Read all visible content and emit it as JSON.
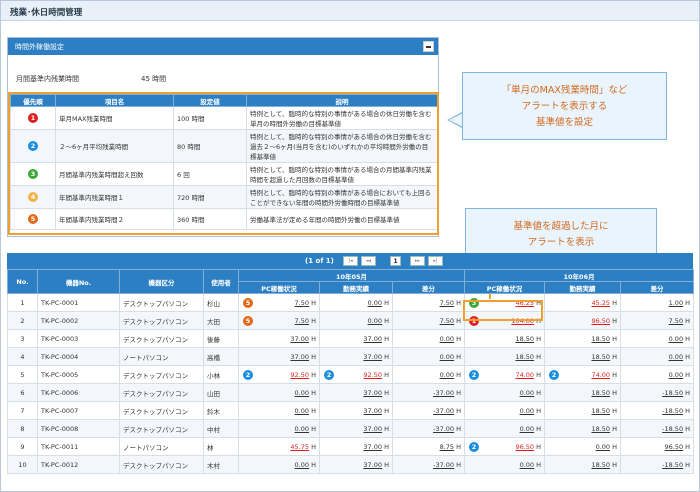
{
  "page": {
    "title": "残業･休日時間管理"
  },
  "panel": {
    "title": "時間外稼働設定",
    "limit_label": "月間基準内残業時間",
    "limit_value": "45 時間"
  },
  "settings": {
    "headers": [
      "優先順",
      "項目名",
      "設定値",
      "説明"
    ],
    "rows": [
      {
        "rank": "1",
        "item": "単月MAX残業時間",
        "value": "100 時間",
        "desc": "特例として、臨時的な特別の事情がある場合の休日労働を含む単月の時間外労働の目標基準値"
      },
      {
        "rank": "2",
        "item": "２～6ヶ月平均残業時間",
        "value": "80 時間",
        "desc": "特例として、臨時的な特別の事情がある場合の休日労働を含む過去２～6ヶ月(当月を含む)のいずれかの平均時間外労働の目標基準値"
      },
      {
        "rank": "3",
        "item": "月間基準内残業時間超え回数",
        "value": "6 回",
        "desc": "特例として、臨時的な特別の事情がある場合の月間基準内残業時間を超過した月回数の目標基準値"
      },
      {
        "rank": "4",
        "item": "年間基準内残業時間１",
        "value": "720 時間",
        "desc": "特例として、臨時的な特別の事情がある場合においても上回ることができない年間の時間外労働時間の目標基準値"
      },
      {
        "rank": "5",
        "item": "年間基準内残業時間２",
        "value": "360 時間",
        "desc": "労働基準法が定める年間の時間外労働の目標基準値"
      }
    ]
  },
  "callouts": {
    "setting_lines": [
      "「単月のMAX残業時間」など",
      "アラートを表示する",
      "基準値を設定"
    ],
    "alert_lines": [
      "基準値を超過した月に",
      "アラートを表示"
    ]
  },
  "pager": {
    "text": "(1 of 1)",
    "current": "1",
    "first": "|◂",
    "prev": "◂◂",
    "next": "▸▸",
    "last": "▸|"
  },
  "grid": {
    "headers": {
      "no": "No.",
      "device_no": "機器No.",
      "category": "機器区分",
      "user": "使用者"
    },
    "months": [
      "10年05月",
      "10年06月"
    ],
    "sub_headers": [
      "PC稼働状況",
      "勤務実績",
      "差分"
    ],
    "unit": "H",
    "rows": [
      {
        "no": "1",
        "device_no": "TK-PC-0001",
        "category": "デスクトップパソコン",
        "user": "杉山",
        "m1": {
          "badge": "5",
          "pc": "7.50",
          "work": "0.00",
          "diff": "7.50",
          "pc_red": false,
          "work_badge": ""
        },
        "m2": {
          "badge": "3",
          "pc": "46.25",
          "work": "45.25",
          "diff": "1.00",
          "pc_red": true,
          "work_red": true,
          "work_badge": ""
        }
      },
      {
        "no": "2",
        "device_no": "TK-PC-0002",
        "category": "デスクトップパソコン",
        "user": "大田",
        "m1": {
          "badge": "5",
          "pc": "7.50",
          "work": "0.00",
          "diff": "7.50",
          "pc_red": false,
          "work_badge": ""
        },
        "m2": {
          "badge": "1",
          "pc": "104.00",
          "work": "96.50",
          "diff": "7.50",
          "pc_red": true,
          "work_red": true,
          "work_badge": ""
        }
      },
      {
        "no": "3",
        "device_no": "TK-PC-0003",
        "category": "デスクトップパソコン",
        "user": "後藤",
        "m1": {
          "badge": "",
          "pc": "37.00",
          "work": "37.00",
          "diff": "0.00",
          "pc_red": false,
          "work_badge": ""
        },
        "m2": {
          "badge": "",
          "pc": "18.50",
          "work": "18.50",
          "diff": "0.00",
          "pc_red": false,
          "work_red": false,
          "work_badge": ""
        }
      },
      {
        "no": "4",
        "device_no": "TK-PC-0004",
        "category": "ノートパソコン",
        "user": "高橋",
        "m1": {
          "badge": "",
          "pc": "37.00",
          "work": "37.00",
          "diff": "0.00",
          "pc_red": false,
          "work_badge": ""
        },
        "m2": {
          "badge": "",
          "pc": "18.50",
          "work": "18.50",
          "diff": "0.00",
          "pc_red": false,
          "work_red": false,
          "work_badge": ""
        }
      },
      {
        "no": "5",
        "device_no": "TK-PC-0005",
        "category": "デスクトップパソコン",
        "user": "小林",
        "m1": {
          "badge": "2",
          "pc": "92.50",
          "work": "92.50",
          "diff": "0.00",
          "pc_red": true,
          "work_red": true,
          "work_badge": "2"
        },
        "m2": {
          "badge": "2",
          "pc": "74.00",
          "work": "74.00",
          "diff": "0.00",
          "pc_red": true,
          "work_red": true,
          "work_badge": "2"
        }
      },
      {
        "no": "6",
        "device_no": "TK-PC-0006",
        "category": "デスクトップパソコン",
        "user": "山田",
        "m1": {
          "badge": "",
          "pc": "0.00",
          "work": "37.00",
          "diff": "-37.00",
          "pc_red": false,
          "work_badge": ""
        },
        "m2": {
          "badge": "",
          "pc": "0.00",
          "work": "18.50",
          "diff": "-18.50",
          "pc_red": false,
          "work_red": false,
          "work_badge": ""
        }
      },
      {
        "no": "7",
        "device_no": "TK-PC-0007",
        "category": "デスクトップパソコン",
        "user": "鈴木",
        "m1": {
          "badge": "",
          "pc": "0.00",
          "work": "37.00",
          "diff": "-37.00",
          "pc_red": false,
          "work_badge": ""
        },
        "m2": {
          "badge": "",
          "pc": "0.00",
          "work": "18.50",
          "diff": "-18.50",
          "pc_red": false,
          "work_red": false,
          "work_badge": ""
        }
      },
      {
        "no": "8",
        "device_no": "TK-PC-0008",
        "category": "デスクトップパソコン",
        "user": "中村",
        "m1": {
          "badge": "",
          "pc": "0.00",
          "work": "37.00",
          "diff": "-37.00",
          "pc_red": false,
          "work_badge": ""
        },
        "m2": {
          "badge": "",
          "pc": "0.00",
          "work": "18.50",
          "diff": "-18.50",
          "pc_red": false,
          "work_red": false,
          "work_badge": ""
        }
      },
      {
        "no": "9",
        "device_no": "TK-PC-0011",
        "category": "ノートパソコン",
        "user": "林",
        "m1": {
          "badge": "",
          "pc": "45.75",
          "work": "37.00",
          "diff": "8.75",
          "pc_red": true,
          "work_badge": ""
        },
        "m2": {
          "badge": "2",
          "pc": "96.50",
          "work": "0.00",
          "diff": "96.50",
          "pc_red": true,
          "work_red": false,
          "work_badge": ""
        }
      },
      {
        "no": "10",
        "device_no": "TK-PC-0012",
        "category": "デスクトップパソコン",
        "user": "木村",
        "m1": {
          "badge": "",
          "pc": "0.00",
          "work": "37.00",
          "diff": "-37.00",
          "pc_red": false,
          "work_badge": ""
        },
        "m2": {
          "badge": "",
          "pc": "0.00",
          "work": "18.50",
          "diff": "-18.50",
          "pc_red": false,
          "work_red": false,
          "work_badge": ""
        }
      }
    ]
  },
  "colors": {
    "header_blue": "#2c7fc3",
    "alert_red": "#e02020",
    "highlight_orange": "#f0a030"
  }
}
